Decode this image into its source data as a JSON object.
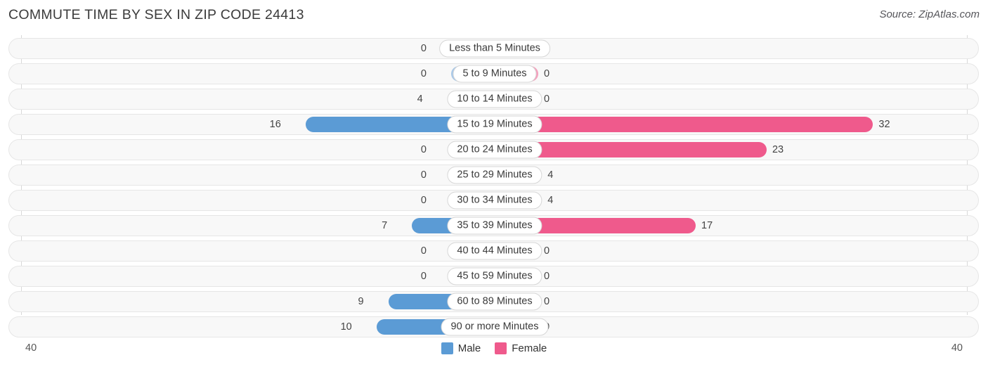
{
  "header": {
    "title": "COMMUTE TIME BY SEX IN ZIP CODE 24413",
    "source": "Source: ZipAtlas.com"
  },
  "axis": {
    "left_label": "40",
    "right_label": "40"
  },
  "legend": {
    "items": [
      {
        "label": "Male",
        "color": "#5b9bd5"
      },
      {
        "label": "Female",
        "color": "#ef5a8c"
      }
    ]
  },
  "colors": {
    "male_strong": "#5b9bd5",
    "male_faded": "#a8c8e8",
    "female_strong": "#ef5a8c",
    "female_faded": "#f4a0bd",
    "track": "#f8f8f8",
    "track_border": "#e6e6e6"
  },
  "chart_data": {
    "type": "bar",
    "title": "COMMUTE TIME BY SEX IN ZIP CODE 24413",
    "subtitle": "",
    "xlabel": "",
    "ylabel": "",
    "orientation": "horizontal-diverging",
    "grid": false,
    "legend_position": "bottom-center",
    "xlim": [
      40,
      40
    ],
    "axis_max": 40,
    "categories": [
      "Less than 5 Minutes",
      "5 to 9 Minutes",
      "10 to 14 Minutes",
      "15 to 19 Minutes",
      "20 to 24 Minutes",
      "25 to 29 Minutes",
      "30 to 34 Minutes",
      "35 to 39 Minutes",
      "40 to 44 Minutes",
      "45 to 59 Minutes",
      "60 to 89 Minutes",
      "90 or more Minutes"
    ],
    "series": [
      {
        "name": "Male",
        "values": [
          0,
          0,
          4,
          16,
          0,
          0,
          0,
          7,
          0,
          0,
          9,
          10
        ]
      },
      {
        "name": "Female",
        "values": [
          0,
          0,
          0,
          32,
          23,
          4,
          4,
          17,
          0,
          0,
          0,
          0
        ]
      }
    ]
  },
  "rows": [
    {
      "label": "Less than 5 Minutes",
      "male": "0",
      "female": "0",
      "male_value": 0,
      "female_value": 0
    },
    {
      "label": "5 to 9 Minutes",
      "male": "0",
      "female": "0",
      "male_value": 0,
      "female_value": 0
    },
    {
      "label": "10 to 14 Minutes",
      "male": "4",
      "female": "0",
      "male_value": 4,
      "female_value": 0
    },
    {
      "label": "15 to 19 Minutes",
      "male": "16",
      "female": "32",
      "male_value": 16,
      "female_value": 32
    },
    {
      "label": "20 to 24 Minutes",
      "male": "0",
      "female": "23",
      "male_value": 0,
      "female_value": 23
    },
    {
      "label": "25 to 29 Minutes",
      "male": "0",
      "female": "4",
      "male_value": 0,
      "female_value": 4
    },
    {
      "label": "30 to 34 Minutes",
      "male": "0",
      "female": "4",
      "male_value": 0,
      "female_value": 4
    },
    {
      "label": "35 to 39 Minutes",
      "male": "7",
      "female": "17",
      "male_value": 7,
      "female_value": 17
    },
    {
      "label": "40 to 44 Minutes",
      "male": "0",
      "female": "0",
      "male_value": 0,
      "female_value": 0
    },
    {
      "label": "45 to 59 Minutes",
      "male": "0",
      "female": "0",
      "male_value": 0,
      "female_value": 0
    },
    {
      "label": "60 to 89 Minutes",
      "male": "9",
      "female": "0",
      "male_value": 9,
      "female_value": 0
    },
    {
      "label": "90 or more Minutes",
      "male": "10",
      "female": "0",
      "male_value": 10,
      "female_value": 0
    }
  ]
}
